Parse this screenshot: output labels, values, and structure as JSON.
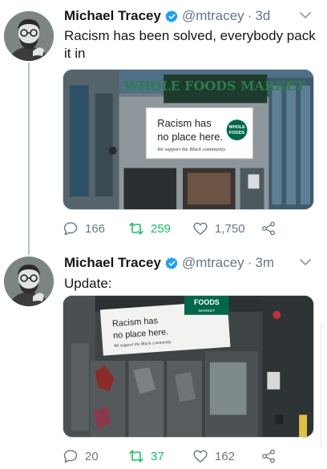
{
  "tweets": [
    {
      "author_name": "Michael Tracey",
      "handle": "@mtracey",
      "time": "3d",
      "text": "Racism has been solved, everybody pack it in",
      "media": {
        "store_sign": "WHOLE FOODS MARKET",
        "banner_line1": "Racism has",
        "banner_line2": "no place here.",
        "banner_line3": "We support the Black community.",
        "logo_top": "WHOLE",
        "logo_bottom": "FOODS"
      },
      "stats": {
        "replies": "166",
        "retweets": "259",
        "likes": "1,750"
      }
    },
    {
      "author_name": "Michael Tracey",
      "handle": "@mtracey",
      "time": "3m",
      "text": "Update:",
      "media": {
        "banner_line1": "Racism has",
        "banner_line2": "no place here.",
        "banner_line3": "We support the Black community.",
        "logo_top": "FOODS",
        "logo_bottom": "MARKET"
      },
      "stats": {
        "replies": "20",
        "retweets": "37",
        "likes": "162"
      }
    }
  ],
  "colors": {
    "verified": "#1da1f2",
    "retweet": "#17bf63",
    "muted": "#657786",
    "text": "#14171a",
    "logo_green": "#00674b"
  },
  "icons": [
    "verified-badge-icon",
    "caret-down-icon",
    "reply-icon",
    "retweet-icon",
    "like-icon",
    "share-icon"
  ]
}
